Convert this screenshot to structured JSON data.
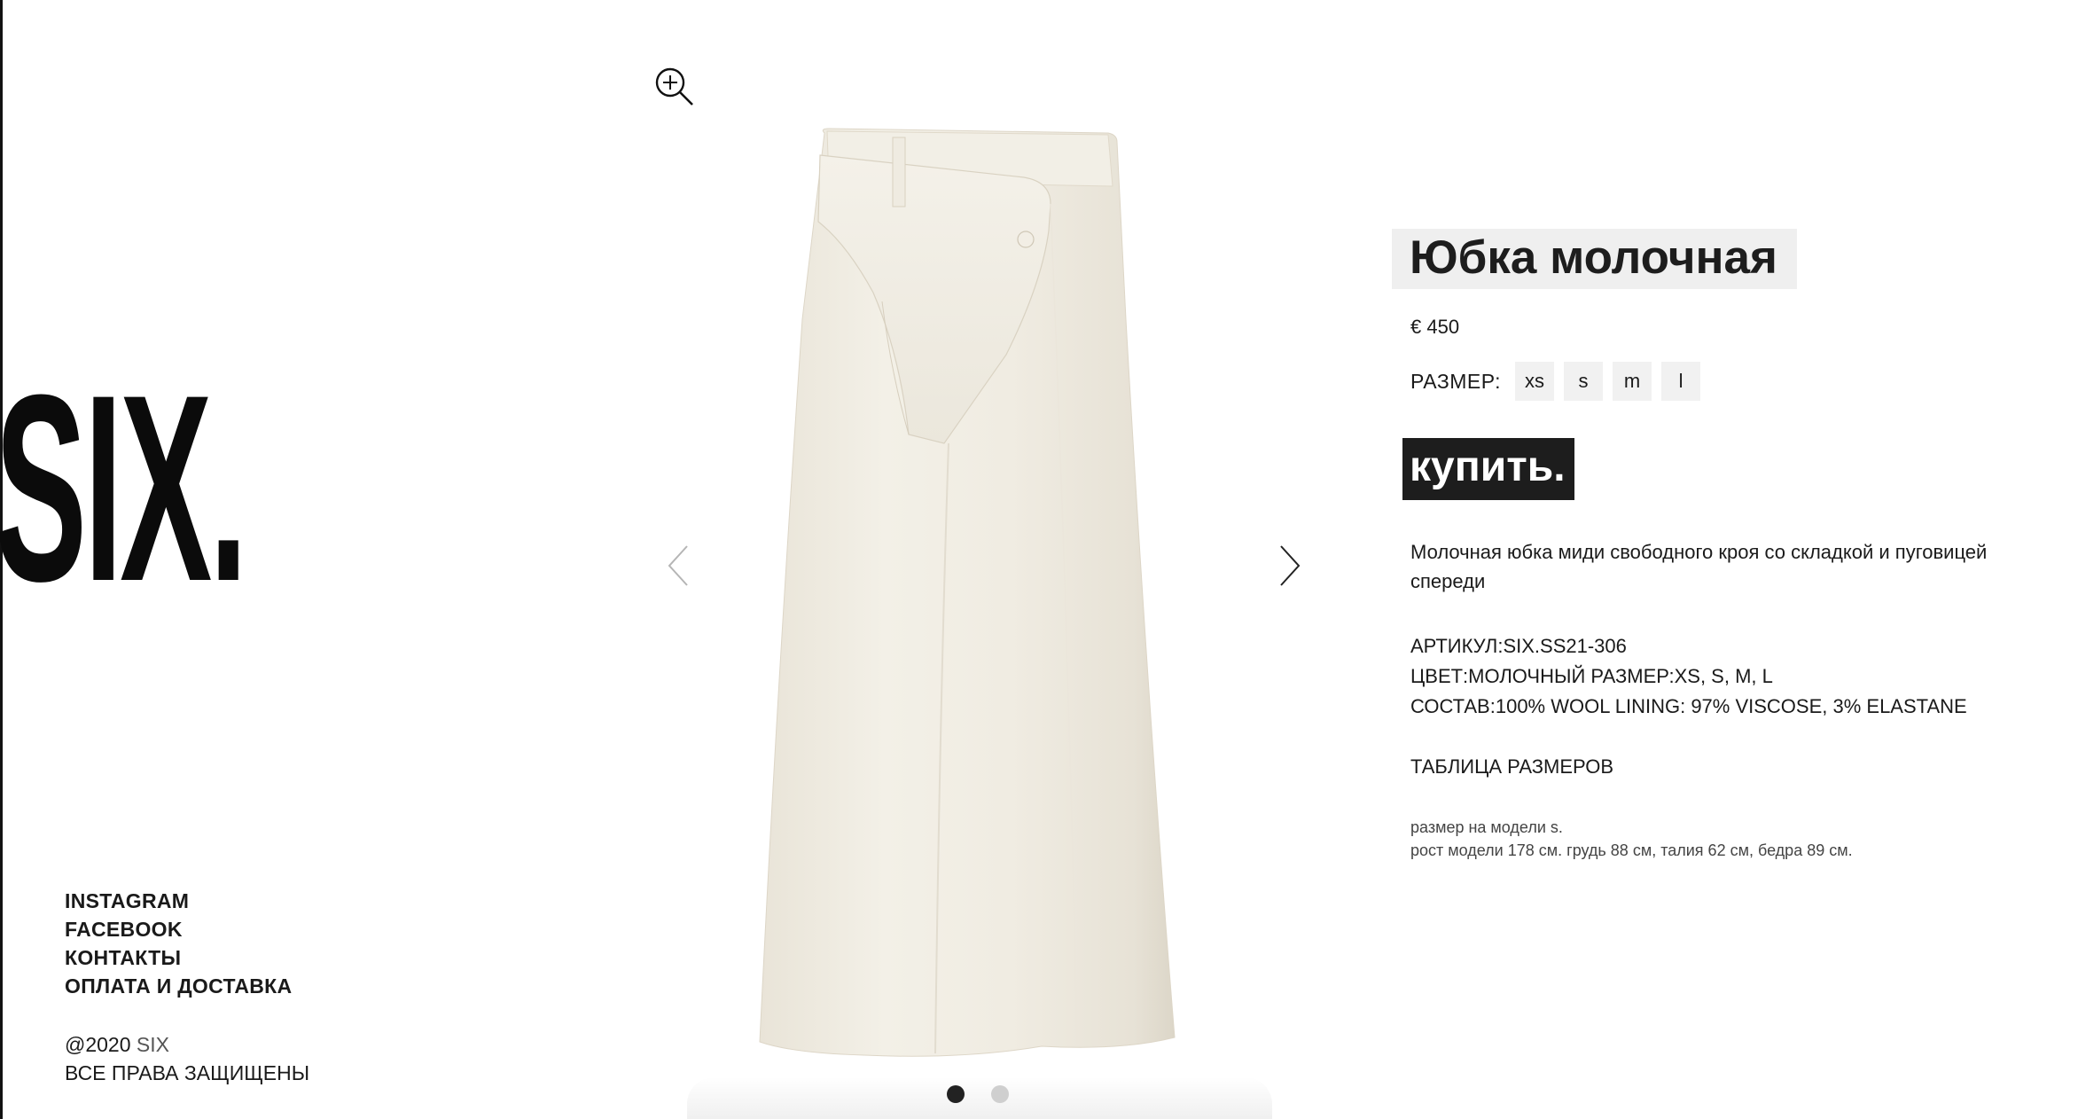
{
  "brand": {
    "logo_text": "SIX."
  },
  "footer": {
    "links": [
      "INSTAGRAM",
      "FACEBOOK",
      "КОНТАКТЫ",
      "ОПЛАТА И ДОСТАВКА"
    ],
    "copyright_prefix": "@2020",
    "copyright_brand": "SIX",
    "rights": "ВСЕ ПРАВА ЗАЩИЩЕНЫ"
  },
  "gallery": {
    "zoom_icon": "zoom-in-icon",
    "prev_icon": "chevron-left-icon",
    "next_icon": "chevron-right-icon",
    "slide_count": 2,
    "active_slide": 1
  },
  "product": {
    "title": "Юбка молочная",
    "price": "€ 450",
    "size_label": "РАЗМЕР:",
    "sizes": [
      "xs",
      "s",
      "m",
      "l"
    ],
    "buy_label": "купить.",
    "description": "Молочная юбка миди свободного кроя со складкой и пуговицей спереди",
    "specs": [
      "АРТИКУЛ:SIX.SS21-306",
      "ЦВЕТ:МОЛОЧНЫЙ РАЗМЕР:XS, S, M, L",
      "СОСТАВ:100% WOOL LINING: 97% VISCOSE, 3% ELASTANE"
    ],
    "size_table_link": "ТАБЛИЦА РАЗМЕРОВ",
    "model_info": [
      "размер на модели s.",
      "рост модели 178 см. грудь 88 см, талия 62 см, бедра 89 см."
    ]
  },
  "colors": {
    "text": "#1a1a1a",
    "title_bg": "#efefef",
    "button_bg": "#1d1d1d",
    "size_bg": "#f1f1f1",
    "skirt": "#f1ede3"
  }
}
